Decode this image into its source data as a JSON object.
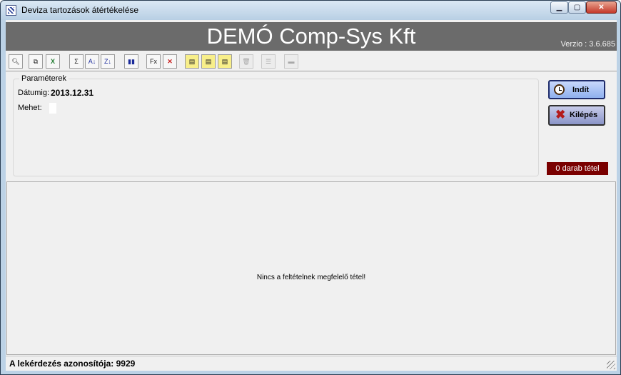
{
  "window": {
    "title": "Deviza tartozások átértékelése",
    "min_glyph": "▁",
    "max_glyph": "▢",
    "close_glyph": "✕"
  },
  "banner": {
    "title": "DEMÓ Comp-Sys Kft",
    "version": "Verzio : 3.6.685"
  },
  "toolbar": {
    "buttons": [
      {
        "icon": "print-preview-icon",
        "glyph": "🔍︎",
        "enabled": true
      },
      {
        "icon": "copy-icon",
        "glyph": "⧉",
        "enabled": true
      },
      {
        "icon": "excel-export-icon",
        "glyph": "X",
        "enabled": true
      },
      {
        "icon": "sum-icon",
        "glyph": "Σ",
        "enabled": true
      },
      {
        "icon": "sort-ascending-icon",
        "glyph": "A↓",
        "enabled": true
      },
      {
        "icon": "sort-descending-icon",
        "glyph": "Z↓",
        "enabled": true
      },
      {
        "icon": "chart-icon",
        "glyph": "▮▮",
        "enabled": true
      },
      {
        "icon": "filter-fx-icon",
        "glyph": "Fx",
        "enabled": true
      },
      {
        "icon": "filter-clear-icon",
        "glyph": "✕",
        "enabled": true
      },
      {
        "icon": "note-icon",
        "glyph": "▤",
        "enabled": true
      },
      {
        "icon": "note-add-icon",
        "glyph": "▤",
        "enabled": true
      },
      {
        "icon": "note-edit-icon",
        "glyph": "▤",
        "enabled": true
      },
      {
        "icon": "delete-icon",
        "glyph": "🗑︎",
        "enabled": false
      },
      {
        "icon": "grid-icon",
        "glyph": "☰",
        "enabled": false
      },
      {
        "icon": "save-icon",
        "glyph": "▬",
        "enabled": false
      }
    ]
  },
  "params": {
    "legend": "Paraméterek",
    "date_label": "Dátumig:",
    "date_value": "2013.12.31",
    "mehet_label": "Mehet:"
  },
  "actions": {
    "start_label": "Indít",
    "exit_label": "Kilépés"
  },
  "count_badge": "0 darab tétel",
  "results": {
    "empty_message": "Nincs a feltételnek megfelelő tétel!"
  },
  "status": {
    "text": "A lekérdezés azonosítója: 9929"
  },
  "colors": {
    "banner_bg": "#6b6b6b",
    "badge_bg": "#7a0000",
    "start_button": "#a8c4f4",
    "close_button": "#c4392a"
  }
}
